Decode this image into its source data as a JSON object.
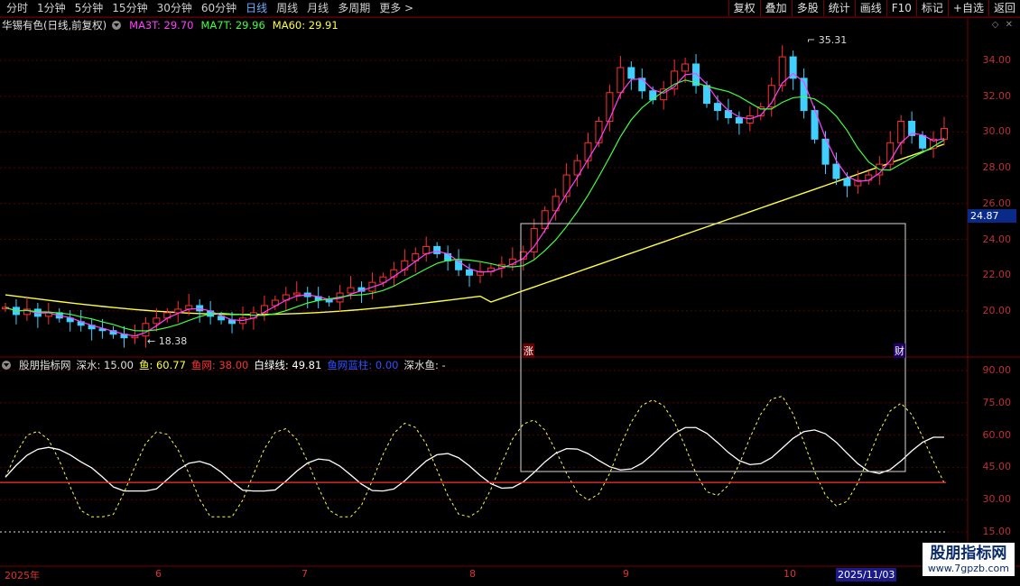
{
  "toolbar": {
    "periods": [
      "分时",
      "1分钟",
      "5分钟",
      "15分钟",
      "30分钟",
      "60分钟",
      "日线",
      "周线",
      "月线",
      "多周期",
      "更多 >"
    ],
    "active_period": "日线",
    "right_buttons": [
      "复权",
      "叠加",
      "多股",
      "统计",
      "画线",
      "F10",
      "标记",
      "+自选",
      "返回"
    ]
  },
  "main_chart": {
    "stock_name": "华锡有色(日线,前复权)",
    "ma_labels": [
      {
        "text": "MA3T: 29.70",
        "color": "#ff40ff"
      },
      {
        "text": "MA7T: 29.96",
        "color": "#40ff40"
      },
      {
        "text": "MA60: 29.91",
        "color": "#ffff40"
      }
    ],
    "y_ticks": [
      "34.00",
      "32.00",
      "30.00",
      "28.00",
      "26.00",
      "24.00",
      "22.00",
      "20.00"
    ],
    "current_price": "24.87",
    "high_label": "35.31",
    "low_label": "18.38",
    "rise_label": "涨",
    "fin_label": "财"
  },
  "indicator": {
    "name": "股朋指标网",
    "items": [
      {
        "text": "深水: 15.00",
        "color": "#e0e0e0"
      },
      {
        "text": "鱼: 60.77",
        "color": "#ffff40"
      },
      {
        "text": "鱼网: 38.00",
        "color": "#ff3030"
      },
      {
        "text": "白绿线: 49.81",
        "color": "#ffffff"
      },
      {
        "text": "鱼网蓝柱: 0.00",
        "color": "#3050ff"
      },
      {
        "text": "深水鱼: -",
        "color": "#e0e0e0"
      }
    ],
    "y_ticks": [
      "90.00",
      "75.00",
      "60.00",
      "45.00",
      "30.00",
      "15.00"
    ]
  },
  "dates": [
    "2025年",
    "6",
    "7",
    "8",
    "9",
    "10"
  ],
  "date_cursor": "2025/11/03",
  "watermark": {
    "title": "股朋指标网",
    "url": "www.7gpzb.com"
  },
  "chart_data": {
    "type": "candlestick",
    "title": "华锡有色(日线,前复权)",
    "ylim": [
      18.38,
      35.31
    ],
    "series": [
      {
        "name": "MA3T",
        "last": 29.7
      },
      {
        "name": "MA7T",
        "last": 29.96
      },
      {
        "name": "MA60",
        "last": 29.91
      }
    ],
    "closes": [
      20.2,
      19.8,
      20.1,
      19.7,
      19.9,
      19.6,
      19.4,
      19.2,
      19.0,
      18.9,
      18.7,
      18.5,
      18.6,
      19.3,
      19.6,
      19.9,
      20.1,
      20.3,
      20.0,
      19.7,
      19.5,
      19.3,
      19.6,
      19.9,
      20.3,
      20.6,
      20.9,
      21.0,
      20.8,
      20.6,
      20.5,
      21.0,
      21.3,
      21.1,
      21.6,
      21.9,
      22.3,
      22.8,
      23.2,
      23.6,
      23.2,
      22.8,
      22.3,
      22.0,
      22.2,
      22.4,
      22.6,
      22.9,
      23.3,
      24.6,
      25.6,
      26.4,
      27.6,
      28.4,
      29.4,
      30.6,
      32.2,
      33.6,
      33.0,
      32.3,
      31.8,
      32.4,
      33.4,
      33.8,
      32.6,
      31.6,
      31.2,
      30.8,
      30.5,
      30.9,
      31.4,
      32.6,
      34.2,
      33.0,
      31.2,
      29.6,
      28.2,
      27.4,
      27.0,
      27.3,
      27.6,
      28.2,
      29.4,
      30.6,
      29.8,
      29.1,
      29.6,
      30.2
    ]
  }
}
